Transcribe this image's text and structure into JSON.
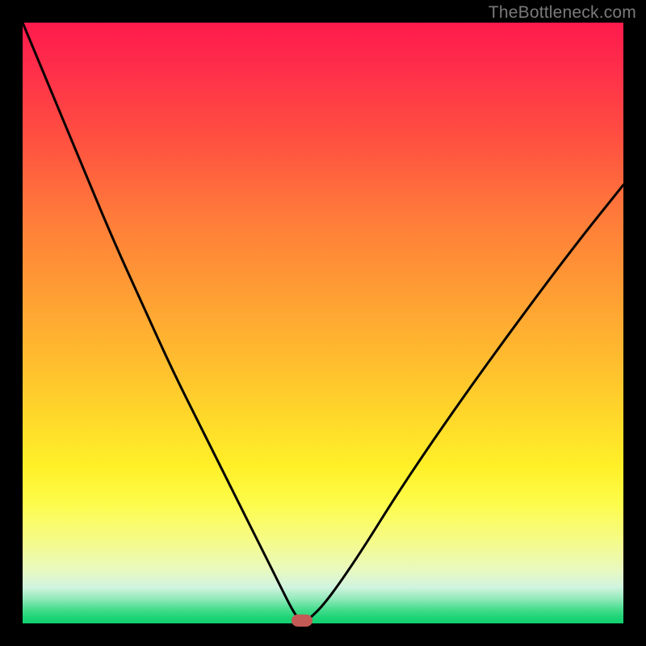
{
  "watermark": "TheBottleneck.com",
  "chart_data": {
    "type": "line",
    "title": "",
    "xlabel": "",
    "ylabel": "",
    "xlim": [
      0,
      100
    ],
    "ylim": [
      0,
      100
    ],
    "series": [
      {
        "name": "bottleneck-curve",
        "x": [
          0,
          5,
          10,
          15,
          20,
          25,
          30,
          35,
          40,
          43,
          45,
          46.5,
          48,
          50,
          53,
          57,
          62,
          68,
          75,
          83,
          92,
          100
        ],
        "y": [
          100,
          88,
          76,
          64,
          53,
          42,
          32,
          22,
          12,
          6,
          2,
          0,
          1,
          3,
          7,
          13,
          21,
          30,
          40,
          51,
          63,
          73
        ]
      }
    ],
    "marker": {
      "x": 46.5,
      "y": 0
    },
    "colors": {
      "curve": "#000000",
      "marker": "#c45a56",
      "gradient_top": "#ff1a4c",
      "gradient_bottom": "#0fd070"
    }
  }
}
